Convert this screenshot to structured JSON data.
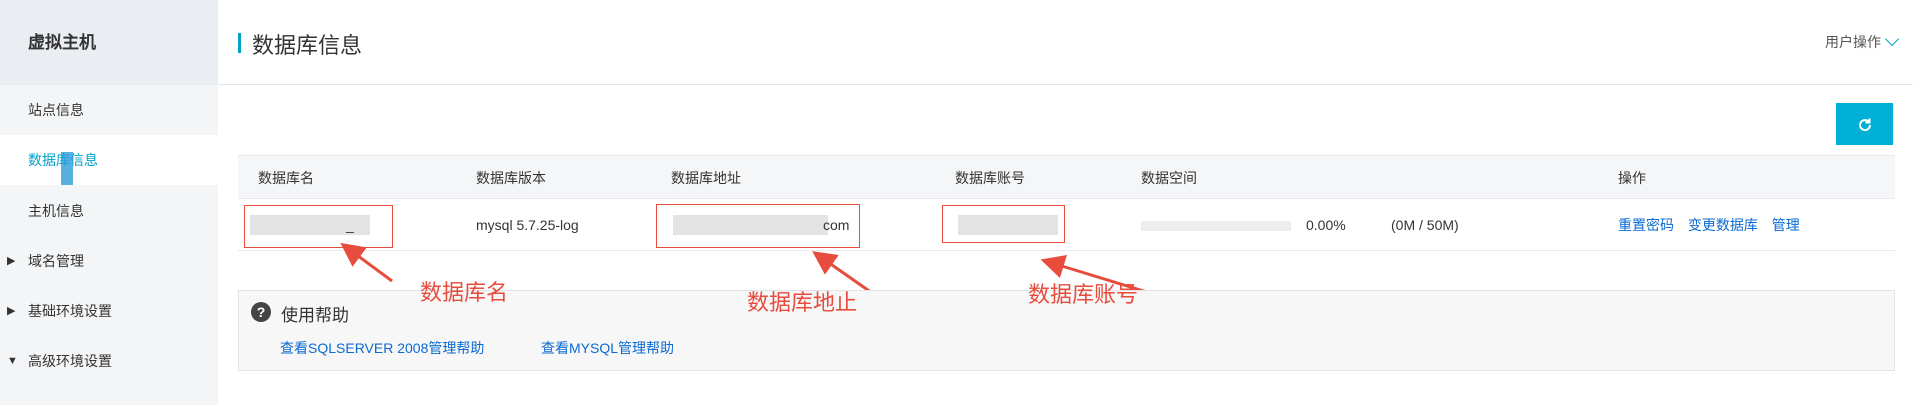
{
  "sidebar": {
    "title": "虚拟主机",
    "items": [
      {
        "label": "站点信息"
      },
      {
        "label": "数据库信息"
      },
      {
        "label": "主机信息"
      },
      {
        "label": "域名管理",
        "caret": "▶"
      },
      {
        "label": "基础环境设置",
        "caret": "▶"
      },
      {
        "label": "高级环境设置",
        "caret": "▼"
      }
    ]
  },
  "header": {
    "title": "数据库信息",
    "user_ops": "用户操作"
  },
  "refresh_icon": "refresh-icon",
  "table": {
    "columns": [
      "数据库名",
      "数据库版本",
      "数据库地址",
      "数据库账号",
      "数据空间",
      "操作"
    ],
    "row": {
      "db_name_tail": "_",
      "version": "mysql 5.7.25-log",
      "address_tail": "com",
      "usage_percent": "0.00%",
      "usage_amount": "(0M / 50M)",
      "usage_fraction": 0,
      "actions": [
        "重置密码",
        "变更数据库",
        "管理"
      ]
    }
  },
  "help": {
    "title": "使用帮助",
    "links": [
      "查看SQLSERVER 2008管理帮助",
      "查看MYSQL管理帮助"
    ]
  },
  "annotations": [
    "数据库名",
    "数据库地止",
    "数据库账号"
  ],
  "colors": {
    "accent": "#00a2ca",
    "annotation": "#e74c3c",
    "link": "#0b6bd1"
  }
}
